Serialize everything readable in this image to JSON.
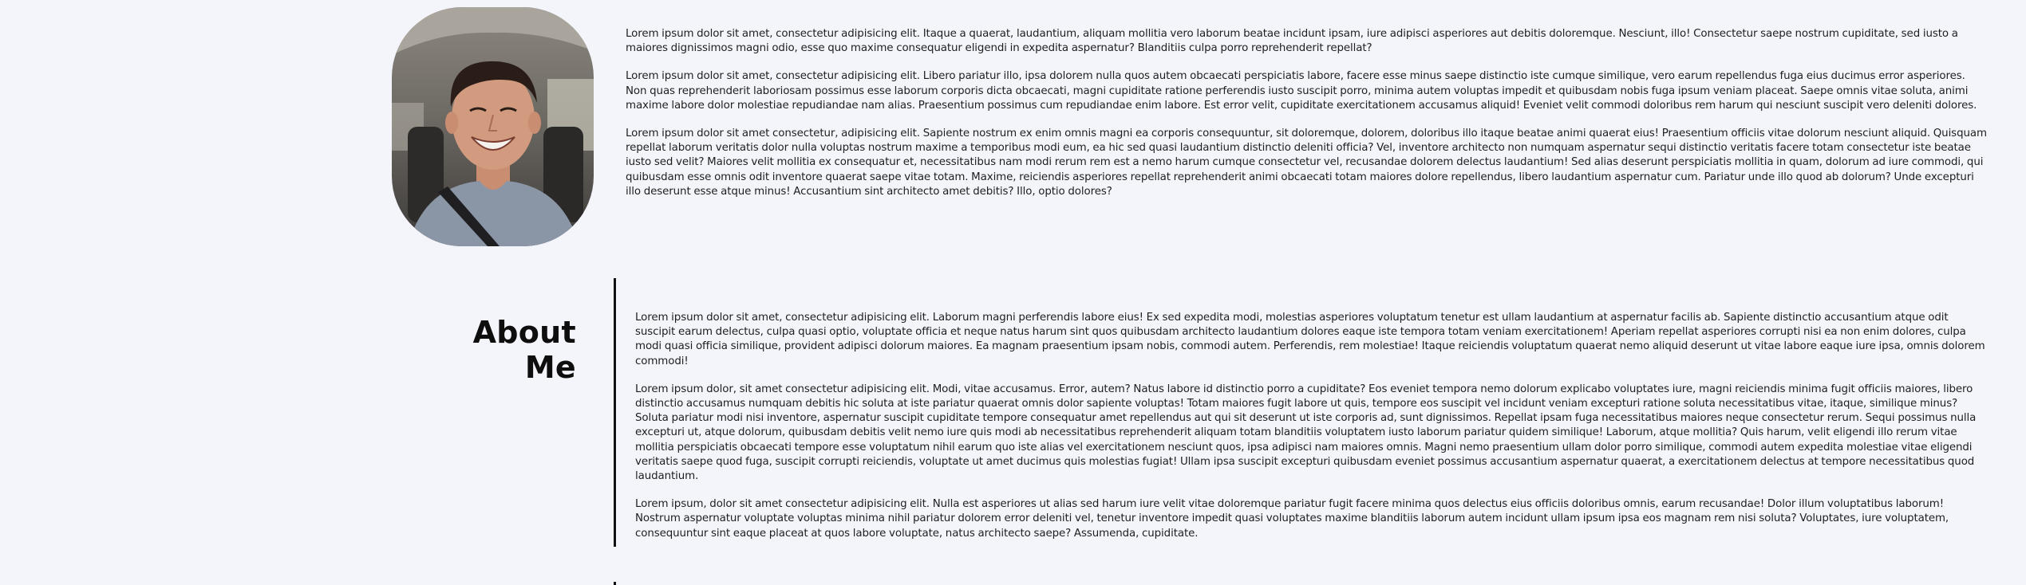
{
  "intro": {
    "photo_alt": "Smiling young man in car seat",
    "paragraphs": [
      "Lorem ipsum dolor sit amet, consectetur adipisicing elit. Itaque a quaerat, laudantium, aliquam mollitia vero laborum beatae incidunt ipsam, iure adipisci asperiores aut debitis doloremque. Nesciunt, illo! Consectetur saepe nostrum cupiditate, sed iusto a maiores dignissimos magni odio, esse quo maxime consequatur eligendi in expedita aspernatur? Blanditiis culpa porro reprehenderit repellat?",
      "Lorem ipsum dolor sit amet, consectetur adipisicing elit. Libero pariatur illo, ipsa dolorem nulla quos autem obcaecati perspiciatis labore, facere esse minus saepe distinctio iste cumque similique, vero earum repellendus fuga eius ducimus error asperiores. Non quas reprehenderit laboriosam possimus esse laborum corporis dicta obcaecati, magni cupiditate ratione perferendis iusto suscipit porro, minima autem voluptas impedit et quibusdam nobis fuga ipsum veniam placeat. Saepe omnis vitae soluta, animi maxime labore dolor molestiae repudiandae nam alias. Praesentium possimus cum repudiandae enim labore. Est error velit, cupiditate exercitationem accusamus aliquid! Eveniet velit commodi doloribus rem harum qui nesciunt suscipit vero deleniti dolores.",
      "Lorem ipsum dolor sit amet consectetur, adipisicing elit. Sapiente nostrum ex enim omnis magni ea corporis consequuntur, sit doloremque, dolorem, doloribus illo itaque beatae animi quaerat eius! Praesentium officiis vitae dolorum nesciunt aliquid. Quisquam repellat laborum veritatis dolor nulla voluptas nostrum maxime a temporibus modi eum, ea hic sed quasi laudantium distinctio deleniti officia? Vel, inventore architecto non numquam aspernatur sequi distinctio veritatis facere totam consectetur iste beatae iusto sed velit? Maiores velit mollitia ex consequatur et, necessitatibus nam modi rerum rem est a nemo harum cumque consectetur vel, recusandae dolorem delectus laudantium! Sed alias deserunt perspiciatis mollitia in quam, dolorum ad iure commodi, qui quibusdam esse omnis odit inventore quaerat saepe vitae totam. Maxime, reiciendis asperiores repellat reprehenderit animi obcaecati totam maiores dolore repellendus, libero laudantium aspernatur cum. Pariatur unde illo quod ab dolorum? Unde excepturi illo deserunt esse atque minus! Accusantium sint architecto amet debitis? Illo, optio dolores?"
    ]
  },
  "about": {
    "title": "About Me",
    "paragraphs": [
      "Lorem ipsum dolor sit amet, consectetur adipisicing elit. Laborum magni perferendis labore eius! Ex sed expedita modi, molestias asperiores voluptatum tenetur est ullam laudantium at aspernatur facilis ab. Sapiente distinctio accusantium atque odit suscipit earum delectus, culpa quasi optio, voluptate officia et neque natus harum sint quos quibusdam architecto laudantium dolores eaque iste tempora totam veniam exercitationem! Aperiam repellat asperiores corrupti nisi ea non enim dolores, culpa modi quasi officia similique, provident adipisci dolorum maiores. Ea magnam praesentium ipsam nobis, commodi autem. Perferendis, rem molestiae! Itaque reiciendis voluptatum quaerat nemo aliquid deserunt ut vitae labore eaque iure ipsa, omnis dolorem commodi!",
      "Lorem ipsum dolor, sit amet consectetur adipisicing elit. Modi, vitae accusamus. Error, autem? Natus labore id distinctio porro a cupiditate? Eos eveniet tempora nemo dolorum explicabo voluptates iure, magni reiciendis minima fugit officiis maiores, libero distinctio accusamus numquam debitis hic soluta at iste pariatur quaerat omnis dolor sapiente voluptas! Totam maiores fugit labore ut quis, tempore eos suscipit vel incidunt veniam excepturi ratione soluta necessitatibus vitae, itaque, similique minus? Soluta pariatur modi nisi inventore, aspernatur suscipit cupiditate tempore consequatur amet repellendus aut qui sit deserunt ut iste corporis ad, sunt dignissimos. Repellat ipsam fuga necessitatibus maiores neque consectetur rerum. Sequi possimus nulla excepturi ut, atque dolorum, quibusdam debitis velit nemo iure quis modi ab necessitatibus reprehenderit aliquam totam blanditiis voluptatem iusto laborum pariatur quidem similique! Laborum, atque mollitia? Quis harum, velit eligendi illo rerum vitae mollitia perspiciatis obcaecati tempore esse voluptatum nihil earum quo iste alias vel exercitationem nesciunt quos, ipsa adipisci nam maiores omnis. Magni nemo praesentium ullam dolor porro similique, commodi autem expedita molestiae vitae eligendi veritatis saepe quod fuga, suscipit corrupti reiciendis, voluptate ut amet ducimus quis molestias fugiat! Ullam ipsa suscipit excepturi quibusdam eveniet possimus accusantium aspernatur quaerat, a exercitationem delectus at tempore necessitatibus quod laudantium.",
      "Lorem ipsum, dolor sit amet consectetur adipisicing elit. Nulla est asperiores ut alias sed harum iure velit vitae doloremque pariatur fugit facere minima quos delectus eius officiis doloribus omnis, earum recusandae! Dolor illum voluptatibus laborum! Nostrum aspernatur voluptate voluptas minima nihil pariatur dolorem error deleniti vel, tenetur inventore impedit quasi voluptates maxime blanditiis laborum autem incidunt ullam ipsum ipsa eos magnam rem nisi soluta? Voluptates, iure voluptatem, consequuntur sint eaque placeat at quos labore voluptate, natus architecto saepe? Assumenda, cupiditate."
    ]
  }
}
